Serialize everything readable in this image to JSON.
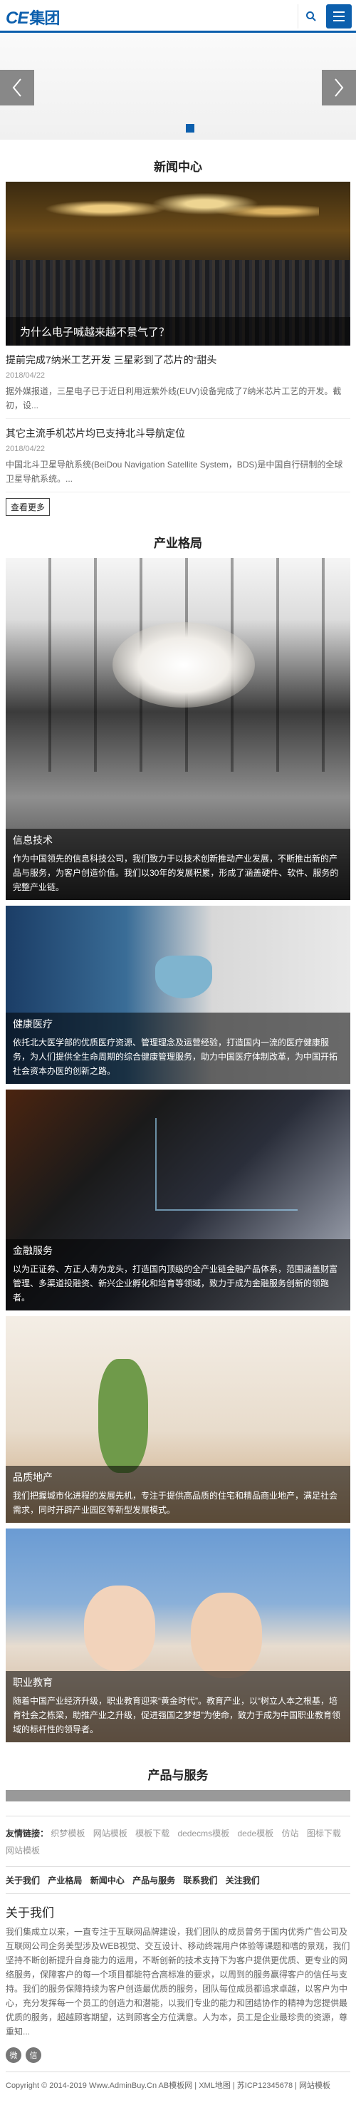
{
  "header": {
    "logo_en": "CE",
    "logo_cn": "集团",
    "search_icon": "search-icon",
    "menu_icon": "hamburger-icon",
    "accent_color": "#0c5fad"
  },
  "banner": {
    "prev_icon": "chevron-left-icon",
    "next_icon": "chevron-right-icon"
  },
  "news": {
    "title": "新闻中心",
    "hero_caption": "为什么电子喊越来越不景气了？",
    "items": [
      {
        "title": "提前完成7纳米工艺开发 三星彩到了芯片的“甜头",
        "date": "2018/04/22",
        "desc": "据外媒报道，三星电子已于近日利用远紫外线(EUV)设备完成了7纳米芯片工艺的开发。截初，设..."
      },
      {
        "title": "其它主流手机芯片均已支持北斗导航定位",
        "date": "2018/04/22",
        "desc": "中国北斗卫星导航系统(BeiDou Navigation Satellite System，BDS)是中国自行研制的全球卫星导航系统。..."
      }
    ],
    "more_label": "查看更多"
  },
  "industry": {
    "title": "产业格局",
    "cards": [
      {
        "name": "信息技术",
        "desc": "作为中国领先的信息科技公司，我们致力于以技术创新推动产业发展，不断推出新的产品与服务，为客户创造价值。我们以30年的发展积累，形成了涵盖硬件、软件、服务的完整产业链。"
      },
      {
        "name": "健康医疗",
        "desc": "依托北大医学部的优质医疗资源、管理理念及运营经验，打造国内一流的医疗健康服务，为人们提供全生命周期的综合健康管理服务，助力中国医疗体制改革，为中国开拓社会资本办医的创新之路。"
      },
      {
        "name": "金融服务",
        "desc": "以为正证券、方正人寿为龙头，打造国内顶级的全产业链金融产品体系，范围涵盖财富管理、多渠道投融资、新兴企业孵化和培育等领域，致力于成为金融服务创新的领跑者。"
      },
      {
        "name": "品质地产",
        "desc": "我们把握城市化进程的发展先机，专注于提供高品质的住宅和精品商业地产，满足社会需求，同时开辟产业园区等新型发展模式。"
      },
      {
        "name": "职业教育",
        "desc": "随着中国产业经济升级，职业教育迎来“黄金时代”。教育产业，以“树立人本之根基，培育社会之栋梁，助推产业之升级，促进强国之梦想”为使命，致力于成为中国职业教育领域的标杆性的领导者。"
      }
    ]
  },
  "products": {
    "title": "产品与服务"
  },
  "friend_links": {
    "label": "友情链接：",
    "links": [
      "织梦模板",
      "网站模板",
      "模板下载",
      "dedecms模板",
      "dede模板",
      "仿站",
      "图标下载",
      "网站模板"
    ]
  },
  "footer_nav": [
    "关于我们",
    "产业格局",
    "新闻中心",
    "产品与服务",
    "联系我们",
    "关注我们"
  ],
  "about": {
    "title": "关于我们",
    "text": "我们集成立以来，一直专注于互联网品牌建设，我们团队的成员曾务于国内优秀广告公司及互联网公司企务美型涉及WEB视觉、交互设计、移动终端用户体验等课题和嗜的景观，我们坚持不断创新提升自身能力的运用，不断创新的技术支持下为客户提供更优质、更专业的网络服务，保障客户的每一个项目都能符合高标准的要求，以周到的服务赢得客户的信任与支持。我们的服务保障持续为客户创造最优质的服务，团队每位成员都追求卓越，以客户为中心，充分发挥每一个员工的创造力和潜能，以我们专业的能力和团结协作的精神为您提供最优质的服务，超越顾客期望，达到顾客全方位满意。人为本，员工是企业最珍贵的资源，尊重知..."
  },
  "social": [
    "weibo-icon",
    "wechat-icon"
  ],
  "copyright": "Copyright © 2014-2019 Www.AdminBuy.Cn AB模板网 | XML地图 | 苏ICP12345678 | 网站模板"
}
